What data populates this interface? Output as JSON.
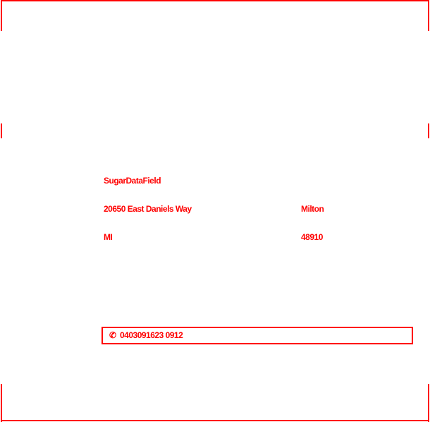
{
  "colors": {
    "accent": "#ff0000",
    "background": "#ffffff"
  },
  "address": {
    "name": "SugarDataField",
    "street": "20650 East Daniels Way",
    "city_label": "Milton",
    "state": "MI",
    "zip": "48910"
  },
  "barcode": {
    "icon": "phone-icon",
    "icon_glyph": "✆",
    "number": "0403091623 0912"
  }
}
